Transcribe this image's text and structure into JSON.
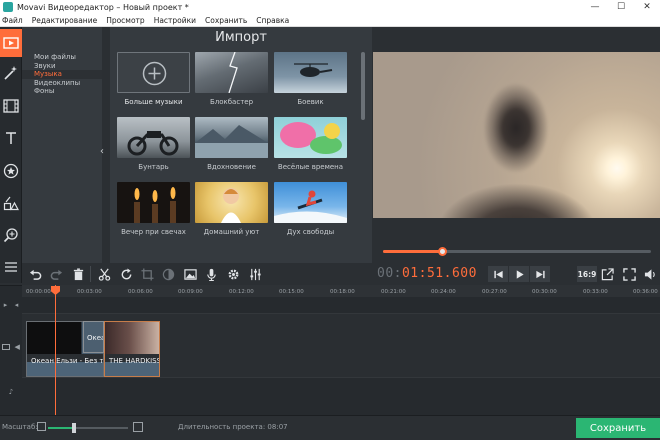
{
  "window": {
    "title": "Movavi Видеоредактор – Новый проект *",
    "controls": [
      "—",
      "☐",
      "✕"
    ]
  },
  "menu": [
    "Файл",
    "Редактирование",
    "Просмотр",
    "Настройки",
    "Сохранить",
    "Справка"
  ],
  "left_tools": [
    "import-icon",
    "magic-wand-icon",
    "filmstrip-icon",
    "text-icon",
    "star-icon",
    "shapes-icon",
    "zoom-icon",
    "menu-icon"
  ],
  "import": {
    "title": "Импорт",
    "categories": [
      "Мои файлы",
      "Звуки",
      "Музыка",
      "Видеоклипы",
      "Фоны"
    ],
    "selected_category": "Музыка",
    "tiles": [
      {
        "label": "Больше музыки"
      },
      {
        "label": "Блокбастер"
      },
      {
        "label": "Боевик"
      },
      {
        "label": "Бунтарь"
      },
      {
        "label": "Вдохновение"
      },
      {
        "label": "Весёлые времена"
      },
      {
        "label": "Вечер при свечах"
      },
      {
        "label": "Домашний уют"
      },
      {
        "label": "Дух свободы"
      }
    ]
  },
  "player": {
    "timecode_prefix": "00:",
    "timecode_main": "01:51.600",
    "progress": 0.22,
    "aspect_ratio": "16:9"
  },
  "timeline": {
    "ticks": [
      "00:00:00",
      "00:03:00",
      "00:06:00",
      "00:09:00",
      "00:12:00",
      "00:15:00",
      "00:18:00",
      "00:21:00",
      "00:24:00",
      "00:27:00",
      "00:30:00",
      "00:33:00",
      "00:36:00"
    ],
    "clips": [
      {
        "name": "Океан Ельзи - Без те"
      },
      {
        "name": "Океа"
      },
      {
        "name": "THE HARDKISS"
      }
    ]
  },
  "status": {
    "zoom_label": "Масштаб:",
    "zoom_level": 0.33,
    "duration_label": "Длительность проекта:",
    "duration_value": "08:07",
    "save_label": "Сохранить"
  },
  "colors": {
    "accent": "#ff6d3b",
    "save": "#2bb673",
    "panel": "#353a3f"
  }
}
